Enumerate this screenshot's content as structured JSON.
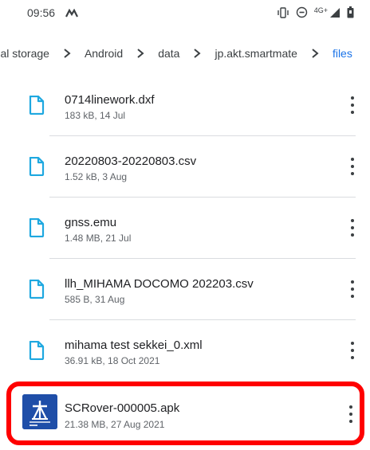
{
  "status": {
    "time": "09:56",
    "network": "4G+"
  },
  "breadcrumb": {
    "items": [
      "rnal storage",
      "Android",
      "data",
      "jp.akt.smartmate",
      "files"
    ]
  },
  "files": [
    {
      "name": "0714linework.dxf",
      "meta": "183 kB, 14 Jul"
    },
    {
      "name": "20220803-20220803.csv",
      "meta": "1.52 kB, 3 Aug"
    },
    {
      "name": "gnss.emu",
      "meta": "1.48 MB, 21 Jul"
    },
    {
      "name": "llh_MIHAMA DOCOMO 202203.csv",
      "meta": "585 B, 31 Aug"
    },
    {
      "name": "mihama test sekkei_0.xml",
      "meta": "36.91 kB, 18 Oct 2021"
    }
  ],
  "apk": {
    "name": "SCRover-000005.apk",
    "meta": "21.38 MB, 27 Aug 2021"
  },
  "colors": {
    "accent": "#1a73e8",
    "file_icon": "#1ea8e0",
    "highlight": "#ff0000",
    "app_icon_bg": "#1f4ea8"
  }
}
